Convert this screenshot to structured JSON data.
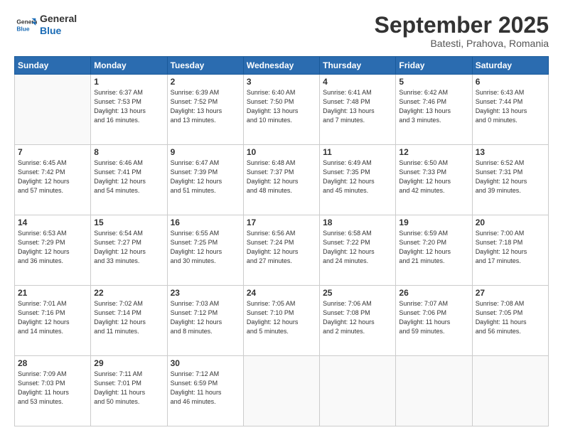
{
  "logo": {
    "line1": "General",
    "line2": "Blue"
  },
  "title": "September 2025",
  "location": "Batesti, Prahova, Romania",
  "weekdays": [
    "Sunday",
    "Monday",
    "Tuesday",
    "Wednesday",
    "Thursday",
    "Friday",
    "Saturday"
  ],
  "weeks": [
    [
      {
        "day": "",
        "info": ""
      },
      {
        "day": "1",
        "info": "Sunrise: 6:37 AM\nSunset: 7:53 PM\nDaylight: 13 hours\nand 16 minutes."
      },
      {
        "day": "2",
        "info": "Sunrise: 6:39 AM\nSunset: 7:52 PM\nDaylight: 13 hours\nand 13 minutes."
      },
      {
        "day": "3",
        "info": "Sunrise: 6:40 AM\nSunset: 7:50 PM\nDaylight: 13 hours\nand 10 minutes."
      },
      {
        "day": "4",
        "info": "Sunrise: 6:41 AM\nSunset: 7:48 PM\nDaylight: 13 hours\nand 7 minutes."
      },
      {
        "day": "5",
        "info": "Sunrise: 6:42 AM\nSunset: 7:46 PM\nDaylight: 13 hours\nand 3 minutes."
      },
      {
        "day": "6",
        "info": "Sunrise: 6:43 AM\nSunset: 7:44 PM\nDaylight: 13 hours\nand 0 minutes."
      }
    ],
    [
      {
        "day": "7",
        "info": "Sunrise: 6:45 AM\nSunset: 7:42 PM\nDaylight: 12 hours\nand 57 minutes."
      },
      {
        "day": "8",
        "info": "Sunrise: 6:46 AM\nSunset: 7:41 PM\nDaylight: 12 hours\nand 54 minutes."
      },
      {
        "day": "9",
        "info": "Sunrise: 6:47 AM\nSunset: 7:39 PM\nDaylight: 12 hours\nand 51 minutes."
      },
      {
        "day": "10",
        "info": "Sunrise: 6:48 AM\nSunset: 7:37 PM\nDaylight: 12 hours\nand 48 minutes."
      },
      {
        "day": "11",
        "info": "Sunrise: 6:49 AM\nSunset: 7:35 PM\nDaylight: 12 hours\nand 45 minutes."
      },
      {
        "day": "12",
        "info": "Sunrise: 6:50 AM\nSunset: 7:33 PM\nDaylight: 12 hours\nand 42 minutes."
      },
      {
        "day": "13",
        "info": "Sunrise: 6:52 AM\nSunset: 7:31 PM\nDaylight: 12 hours\nand 39 minutes."
      }
    ],
    [
      {
        "day": "14",
        "info": "Sunrise: 6:53 AM\nSunset: 7:29 PM\nDaylight: 12 hours\nand 36 minutes."
      },
      {
        "day": "15",
        "info": "Sunrise: 6:54 AM\nSunset: 7:27 PM\nDaylight: 12 hours\nand 33 minutes."
      },
      {
        "day": "16",
        "info": "Sunrise: 6:55 AM\nSunset: 7:25 PM\nDaylight: 12 hours\nand 30 minutes."
      },
      {
        "day": "17",
        "info": "Sunrise: 6:56 AM\nSunset: 7:24 PM\nDaylight: 12 hours\nand 27 minutes."
      },
      {
        "day": "18",
        "info": "Sunrise: 6:58 AM\nSunset: 7:22 PM\nDaylight: 12 hours\nand 24 minutes."
      },
      {
        "day": "19",
        "info": "Sunrise: 6:59 AM\nSunset: 7:20 PM\nDaylight: 12 hours\nand 21 minutes."
      },
      {
        "day": "20",
        "info": "Sunrise: 7:00 AM\nSunset: 7:18 PM\nDaylight: 12 hours\nand 17 minutes."
      }
    ],
    [
      {
        "day": "21",
        "info": "Sunrise: 7:01 AM\nSunset: 7:16 PM\nDaylight: 12 hours\nand 14 minutes."
      },
      {
        "day": "22",
        "info": "Sunrise: 7:02 AM\nSunset: 7:14 PM\nDaylight: 12 hours\nand 11 minutes."
      },
      {
        "day": "23",
        "info": "Sunrise: 7:03 AM\nSunset: 7:12 PM\nDaylight: 12 hours\nand 8 minutes."
      },
      {
        "day": "24",
        "info": "Sunrise: 7:05 AM\nSunset: 7:10 PM\nDaylight: 12 hours\nand 5 minutes."
      },
      {
        "day": "25",
        "info": "Sunrise: 7:06 AM\nSunset: 7:08 PM\nDaylight: 12 hours\nand 2 minutes."
      },
      {
        "day": "26",
        "info": "Sunrise: 7:07 AM\nSunset: 7:06 PM\nDaylight: 11 hours\nand 59 minutes."
      },
      {
        "day": "27",
        "info": "Sunrise: 7:08 AM\nSunset: 7:05 PM\nDaylight: 11 hours\nand 56 minutes."
      }
    ],
    [
      {
        "day": "28",
        "info": "Sunrise: 7:09 AM\nSunset: 7:03 PM\nDaylight: 11 hours\nand 53 minutes."
      },
      {
        "day": "29",
        "info": "Sunrise: 7:11 AM\nSunset: 7:01 PM\nDaylight: 11 hours\nand 50 minutes."
      },
      {
        "day": "30",
        "info": "Sunrise: 7:12 AM\nSunset: 6:59 PM\nDaylight: 11 hours\nand 46 minutes."
      },
      {
        "day": "",
        "info": ""
      },
      {
        "day": "",
        "info": ""
      },
      {
        "day": "",
        "info": ""
      },
      {
        "day": "",
        "info": ""
      }
    ]
  ]
}
